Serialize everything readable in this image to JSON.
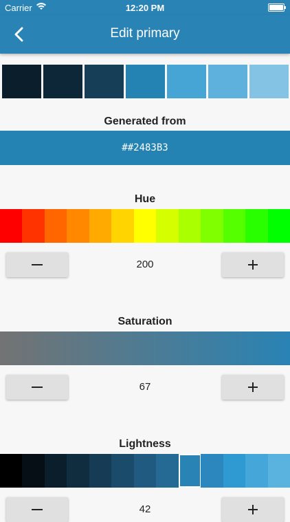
{
  "status_bar": {
    "carrier": "Carrier",
    "time": "12:20 PM"
  },
  "nav": {
    "title": "Edit primary",
    "back_icon": "chevron-left-icon"
  },
  "colors": {
    "primary": "#2483b3",
    "bar": "#2983b4"
  },
  "palette": [
    "#0b1e2b",
    "#0d2638",
    "#163f57",
    "#2483b3",
    "#47a5d6",
    "#5eb0dd",
    "#85c3e5"
  ],
  "generated": {
    "title": "Generated from",
    "value": "##2483B3"
  },
  "hue": {
    "title": "Hue",
    "value": "200",
    "colors": [
      "#ff0000",
      "#ff3300",
      "#ff6600",
      "#ff8800",
      "#ffaa00",
      "#ffd400",
      "#ffff00",
      "#d5ff00",
      "#aaff00",
      "#80ff00",
      "#55ff00",
      "#2aff00",
      "#00ff00"
    ]
  },
  "saturation": {
    "title": "Saturation",
    "value": "67",
    "start_color": "#737373",
    "end_color": "#2983b4"
  },
  "lightness": {
    "title": "Lightness",
    "value": "42",
    "colors": [
      "#000000",
      "#050f15",
      "#0b1e2b",
      "#102d40",
      "#163c55",
      "#1b4b6a",
      "#205a80",
      "#256a95",
      "#2983b4",
      "#2b87bd",
      "#2f99d2",
      "#45a7d9",
      "#5ab2df"
    ],
    "selected_index": 8
  },
  "stepper": {
    "minus_icon": "minus-icon",
    "plus_icon": "plus-icon"
  }
}
